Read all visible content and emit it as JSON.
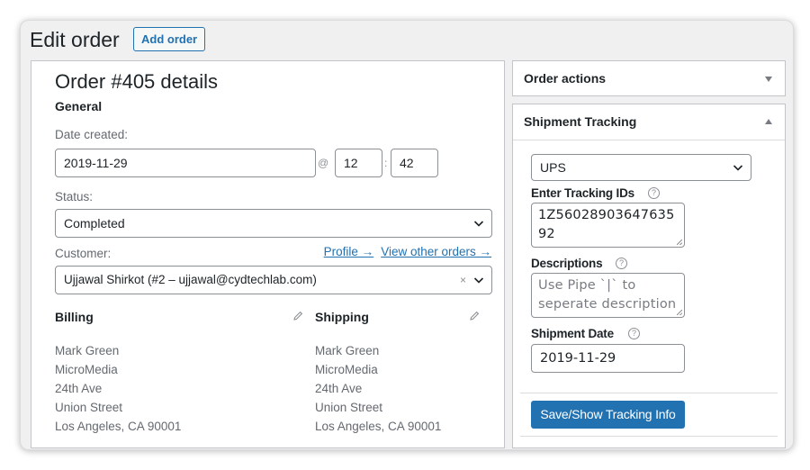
{
  "header": {
    "title": "Edit order",
    "add_order_label": "Add order"
  },
  "order": {
    "heading": "Order #405 details",
    "section_general": "General",
    "date_label": "Date created:",
    "date_value": "2019-11-29",
    "at_symbol": "@",
    "hour_value": "12",
    "time_sep": ":",
    "minute_value": "42",
    "status_label": "Status:",
    "status_value": "Completed",
    "customer_label": "Customer:",
    "profile_link": "Profile →",
    "view_orders_link": "View other orders →",
    "customer_value": "Ujjawal Shirkot (#2 – ujjawal@cydtechlab.com)",
    "clear_glyph": "×",
    "billing": {
      "heading": "Billing",
      "lines": [
        "Mark Green",
        "MicroMedia",
        "24th Ave",
        "Union Street",
        "Los Angeles, CA 90001"
      ]
    },
    "shipping": {
      "heading": "Shipping",
      "lines": [
        "Mark Green",
        "MicroMedia",
        "24th Ave",
        "Union Street",
        "Los Angeles, CA 90001"
      ]
    }
  },
  "sidebar": {
    "order_actions": {
      "title": "Order actions",
      "state": "collapsed"
    },
    "shipment_tracking": {
      "title": "Shipment Tracking",
      "state": "expanded",
      "carrier_value": "UPS",
      "tracking_label": "Enter Tracking IDs",
      "tracking_value": "1Z5602890364763592",
      "descriptions_label": "Descriptions",
      "descriptions_placeholder": "Use Pipe `|` to seperate description",
      "date_label": "Shipment Date",
      "date_value": "2019-11-29",
      "save_label": "Save/Show Tracking Info",
      "help_glyph": "?"
    }
  },
  "colors": {
    "accent": "#2271b1",
    "panel_bg": "#f0f0f1",
    "border": "#c3c4c7"
  }
}
